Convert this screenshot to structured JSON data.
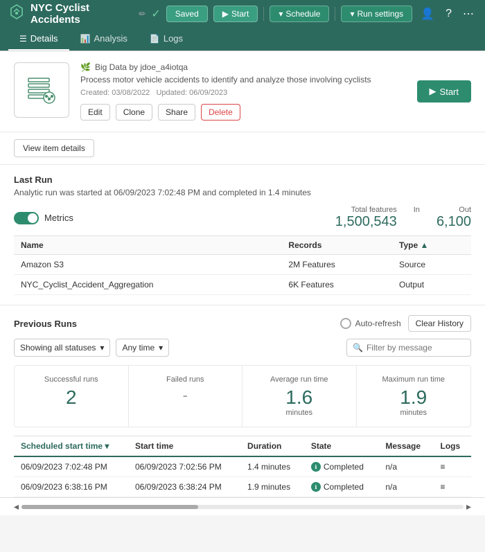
{
  "header": {
    "title": "NYC Cyclist Accidents",
    "saved_label": "Saved",
    "start_label": "Start",
    "schedule_label": "Schedule",
    "run_settings_label": "Run settings"
  },
  "nav": {
    "tabs": [
      {
        "id": "details",
        "label": "Details",
        "icon": "☰",
        "active": true
      },
      {
        "id": "analysis",
        "label": "Analysis",
        "icon": "📊",
        "active": false
      },
      {
        "id": "logs",
        "label": "Logs",
        "icon": "📄",
        "active": false
      }
    ]
  },
  "info": {
    "owner": "Big Data by jdoe_a4iotqa",
    "description": "Process motor vehicle accidents to identify and analyze those involving cyclists",
    "created": "Created: 03/08/2022",
    "updated": "Updated: 06/09/2023",
    "edit_label": "Edit",
    "clone_label": "Clone",
    "share_label": "Share",
    "delete_label": "Delete",
    "start_label": "Start"
  },
  "view_details": {
    "button_label": "View item details"
  },
  "last_run": {
    "title": "Last Run",
    "description": "Analytic run was started at 06/09/2023 7:02:48 PM and completed in 1.4 minutes",
    "metrics_label": "Metrics",
    "total_features_label": "Total features",
    "total_features_value": "1,500,543",
    "in_label": "In",
    "in_value": "",
    "out_label": "Out",
    "out_value": "6,100"
  },
  "data_table": {
    "columns": [
      "Name",
      "Records",
      "Type"
    ],
    "rows": [
      {
        "name": "Amazon S3",
        "records": "2M Features",
        "type": "Source"
      },
      {
        "name": "NYC_Cyclist_Accident_Aggregation",
        "records": "6K Features",
        "type": "Output"
      }
    ]
  },
  "previous_runs": {
    "title": "Previous Runs",
    "auto_refresh_label": "Auto-refresh",
    "clear_history_label": "Clear History",
    "status_filter": "Showing all statuses",
    "time_filter": "Any time",
    "search_placeholder": "Filter by message",
    "stats": {
      "successful_runs_label": "Successful runs",
      "successful_runs_value": "2",
      "failed_runs_label": "Failed runs",
      "failed_runs_value": "-",
      "avg_run_time_label": "Average run time",
      "avg_run_time_value": "1.6",
      "avg_run_time_unit": "minutes",
      "max_run_time_label": "Maximum run time",
      "max_run_time_value": "1.9",
      "max_run_time_unit": "minutes"
    },
    "table_columns": [
      {
        "label": "Scheduled start time",
        "sort": true,
        "active": true
      },
      {
        "label": "Start time",
        "sort": false
      },
      {
        "label": "Duration",
        "sort": false
      },
      {
        "label": "State",
        "sort": false
      },
      {
        "label": "Message",
        "sort": false
      },
      {
        "label": "Logs",
        "sort": false
      }
    ],
    "runs": [
      {
        "scheduled": "06/09/2023 7:02:48 PM",
        "start_time": "06/09/2023 7:02:56 PM",
        "duration": "1.4 minutes",
        "state": "Completed",
        "message": "n/a",
        "logs": "≡"
      },
      {
        "scheduled": "06/09/2023 6:38:16 PM",
        "start_time": "06/09/2023 6:38:24 PM",
        "duration": "1.9 minutes",
        "state": "Completed",
        "message": "n/a",
        "logs": "≡"
      }
    ]
  }
}
